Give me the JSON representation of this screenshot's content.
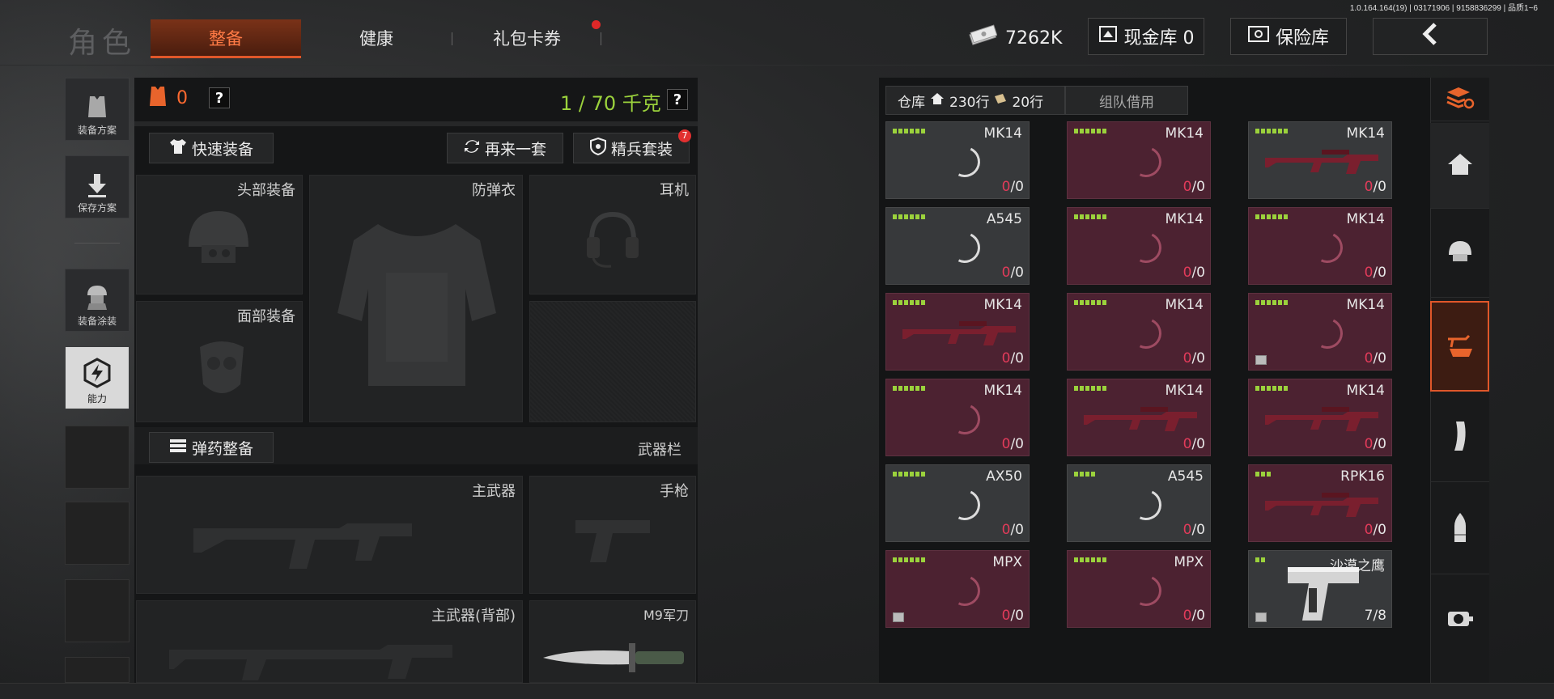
{
  "version": "1.0.164.164(19) | 03171906 | 9158836299 | 品质1~6",
  "header": {
    "title": "角色",
    "tabs": [
      "整备",
      "健康",
      "礼包卡券"
    ],
    "currency": "7262K",
    "cash_vault": "现金库 0",
    "safe_box": "保险库"
  },
  "sidebar": {
    "items": [
      "装备方案",
      "保存方案",
      "装备涂装",
      "能力"
    ]
  },
  "loadout": {
    "armor_count": "0",
    "weight": "1 / 70 千克",
    "help": "?",
    "quick_equip": "快速装备",
    "reroll": "再来一套",
    "elite_set": "精兵套装",
    "elite_badge": "7",
    "slots": {
      "head": "头部装备",
      "vest": "防弹衣",
      "headset": "耳机",
      "face": "面部装备",
      "ammo": "弹药整备",
      "weapon_bar": "武器栏",
      "primary": "主武器",
      "pistol": "手枪",
      "primary_back": "主武器(背部)",
      "knife": "M9军刀"
    }
  },
  "inventory": {
    "tab_label": "仓库",
    "rows_total": "230行",
    "rows_used": "20行",
    "team_loan": "组队借用",
    "items": [
      {
        "name": "MK14",
        "zero": "0",
        "total": "/0",
        "style": "grey",
        "dots": 6
      },
      {
        "name": "MK14",
        "zero": "0",
        "total": "/0",
        "style": "pink",
        "dots": 6
      },
      {
        "name": "MK14",
        "zero": "0",
        "total": "/0",
        "style": "grey",
        "dots": 6
      },
      {
        "name": "A545",
        "zero": "0",
        "total": "/0",
        "style": "grey",
        "dots": 6
      },
      {
        "name": "MK14",
        "zero": "0",
        "total": "/0",
        "style": "pink",
        "dots": 6
      },
      {
        "name": "MK14",
        "zero": "0",
        "total": "/0",
        "style": "pink",
        "dots": 6
      },
      {
        "name": "MK14",
        "zero": "0",
        "total": "/0",
        "style": "pink",
        "dots": 6
      },
      {
        "name": "MK14",
        "zero": "0",
        "total": "/0",
        "style": "pink",
        "dots": 6
      },
      {
        "name": "MK14",
        "zero": "0",
        "total": "/0",
        "style": "pink",
        "dots": 6
      },
      {
        "name": "MK14",
        "zero": "0",
        "total": "/0",
        "style": "pink",
        "dots": 6
      },
      {
        "name": "MK14",
        "zero": "0",
        "total": "/0",
        "style": "pink",
        "dots": 6
      },
      {
        "name": "MK14",
        "zero": "0",
        "total": "/0",
        "style": "pink",
        "dots": 6
      },
      {
        "name": "AX50",
        "zero": "0",
        "total": "/0",
        "style": "grey",
        "dots": 6
      },
      {
        "name": "A545",
        "zero": "0",
        "total": "/0",
        "style": "grey",
        "dots": 4
      },
      {
        "name": "RPK16",
        "zero": "0",
        "total": "/0",
        "style": "pink",
        "dots": 3
      },
      {
        "name": "MPX",
        "zero": "0",
        "total": "/0",
        "style": "pink",
        "dots": 6
      },
      {
        "name": "MPX",
        "zero": "0",
        "total": "/0",
        "style": "pink",
        "dots": 6
      },
      {
        "name": "沙漠之鹰",
        "zero": "",
        "total": "7/8",
        "style": "grey",
        "dots": 2
      }
    ]
  }
}
